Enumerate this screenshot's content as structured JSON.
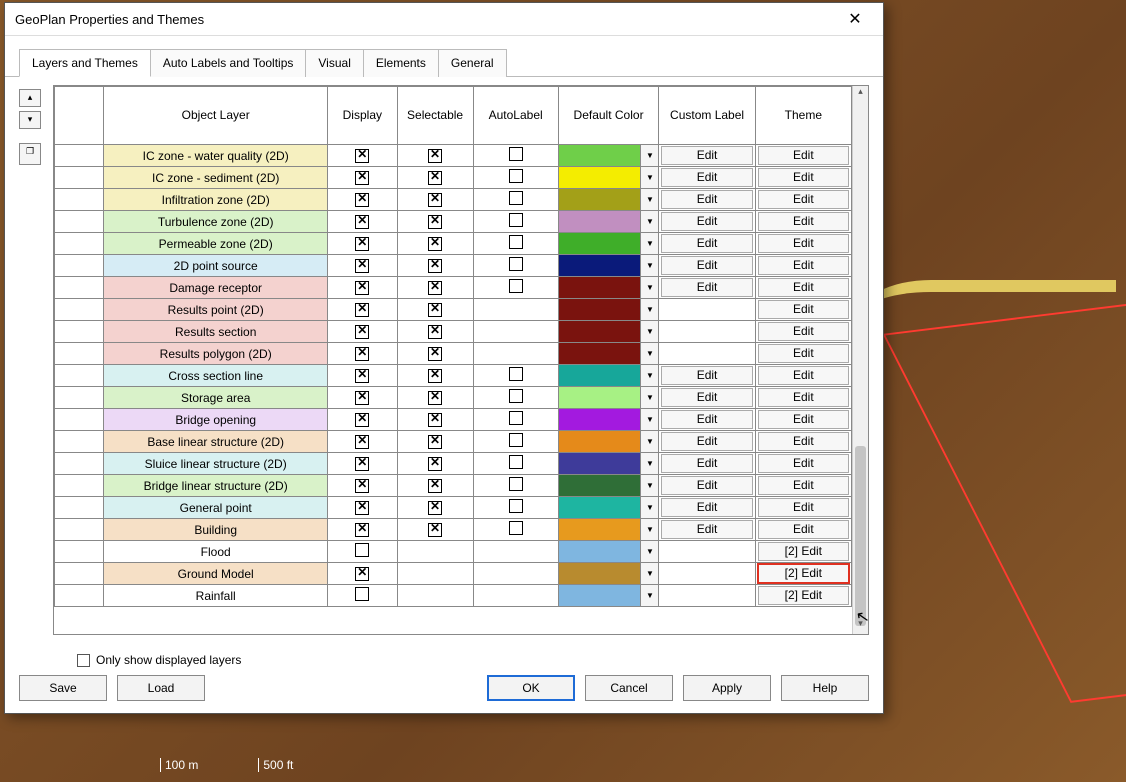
{
  "window": {
    "title": "GeoPlan Properties and Themes"
  },
  "tabs": [
    "Layers and Themes",
    "Auto Labels and Tooltips",
    "Visual",
    "Elements",
    "General"
  ],
  "active_tab": 0,
  "columns": {
    "object_layer": "Object Layer",
    "display": "Display",
    "selectable": "Selectable",
    "auto_label": "AutoLabel",
    "default_color": "Default Color",
    "custom_label": "Custom Label",
    "theme": "Theme"
  },
  "rows": [
    {
      "name": "IC zone - water quality (2D)",
      "bg": "#f6f0c0",
      "display": true,
      "selectable": true,
      "autolabel": false,
      "color": "#6fcf49",
      "custom": "Edit",
      "theme": "Edit"
    },
    {
      "name": "IC zone - sediment (2D)",
      "bg": "#f6f0c0",
      "display": true,
      "selectable": true,
      "autolabel": false,
      "color": "#f4ed00",
      "custom": "Edit",
      "theme": "Edit"
    },
    {
      "name": "Infiltration zone (2D)",
      "bg": "#f6f0c0",
      "display": true,
      "selectable": true,
      "autolabel": false,
      "color": "#a3a018",
      "custom": "Edit",
      "theme": "Edit"
    },
    {
      "name": "Turbulence zone (2D)",
      "bg": "#d9f2c9",
      "display": true,
      "selectable": true,
      "autolabel": false,
      "color": "#c18fc0",
      "custom": "Edit",
      "theme": "Edit"
    },
    {
      "name": "Permeable zone (2D)",
      "bg": "#d9f2c9",
      "display": true,
      "selectable": true,
      "autolabel": false,
      "color": "#3fae29",
      "custom": "Edit",
      "theme": "Edit"
    },
    {
      "name": "2D point source",
      "bg": "#d6ecf5",
      "display": true,
      "selectable": true,
      "autolabel": false,
      "color": "#0a1a7a",
      "custom": "Edit",
      "theme": "Edit"
    },
    {
      "name": "Damage receptor",
      "bg": "#f4d2cf",
      "display": true,
      "selectable": true,
      "autolabel": false,
      "color": "#7a130e",
      "custom": "Edit",
      "theme": "Edit"
    },
    {
      "name": "Results point (2D)",
      "bg": "#f4d2cf",
      "display": true,
      "selectable": true,
      "autolabel": null,
      "color": "#7a130e",
      "custom": null,
      "theme": "Edit"
    },
    {
      "name": "Results section",
      "bg": "#f4d2cf",
      "display": true,
      "selectable": true,
      "autolabel": null,
      "color": "#7a130e",
      "custom": null,
      "theme": "Edit"
    },
    {
      "name": "Results polygon (2D)",
      "bg": "#f4d2cf",
      "display": true,
      "selectable": true,
      "autolabel": null,
      "color": "#7a130e",
      "custom": null,
      "theme": "Edit"
    },
    {
      "name": "Cross section line",
      "bg": "#d8f1f1",
      "display": true,
      "selectable": true,
      "autolabel": false,
      "color": "#17a79a",
      "custom": "Edit",
      "theme": "Edit"
    },
    {
      "name": "Storage area",
      "bg": "#d9f2c9",
      "display": true,
      "selectable": true,
      "autolabel": false,
      "color": "#a7f184",
      "custom": "Edit",
      "theme": "Edit"
    },
    {
      "name": "Bridge opening",
      "bg": "#ecd9f6",
      "display": true,
      "selectable": true,
      "autolabel": false,
      "color": "#a31adf",
      "custom": "Edit",
      "theme": "Edit"
    },
    {
      "name": "Base linear structure (2D)",
      "bg": "#f6e0c6",
      "display": true,
      "selectable": true,
      "autolabel": false,
      "color": "#e58a1a",
      "custom": "Edit",
      "theme": "Edit"
    },
    {
      "name": "Sluice linear structure (2D)",
      "bg": "#d8f1f1",
      "display": true,
      "selectable": true,
      "autolabel": false,
      "color": "#3e3b9a",
      "custom": "Edit",
      "theme": "Edit"
    },
    {
      "name": "Bridge linear structure (2D)",
      "bg": "#d9f2c9",
      "display": true,
      "selectable": true,
      "autolabel": false,
      "color": "#2f6e37",
      "custom": "Edit",
      "theme": "Edit"
    },
    {
      "name": "General point",
      "bg": "#d8f1f1",
      "display": true,
      "selectable": true,
      "autolabel": false,
      "color": "#1eb5a1",
      "custom": "Edit",
      "theme": "Edit"
    },
    {
      "name": "Building",
      "bg": "#f6e0c6",
      "display": true,
      "selectable": true,
      "autolabel": false,
      "color": "#e79a1e",
      "custom": "Edit",
      "theme": "Edit"
    },
    {
      "name": "Flood",
      "bg": "#ffffff",
      "display": false,
      "selectable": null,
      "autolabel": null,
      "color": "#7fb6e0",
      "custom": null,
      "theme": "[2] Edit"
    },
    {
      "name": "Ground Model",
      "bg": "#f6e0c6",
      "display": true,
      "selectable": null,
      "autolabel": null,
      "color": "#b88b2f",
      "custom": null,
      "theme": "[2] Edit",
      "theme_highlight": true
    },
    {
      "name": "Rainfall",
      "bg": "#ffffff",
      "display": false,
      "selectable": null,
      "autolabel": null,
      "color": "#7fb6e0",
      "custom": null,
      "theme": "[2] Edit"
    }
  ],
  "only_show_label": "Only show displayed layers",
  "buttons": {
    "save": "Save",
    "load": "Load",
    "ok": "OK",
    "cancel": "Cancel",
    "apply": "Apply",
    "help": "Help"
  },
  "scale": {
    "left": "100 m",
    "right": "500 ft"
  }
}
